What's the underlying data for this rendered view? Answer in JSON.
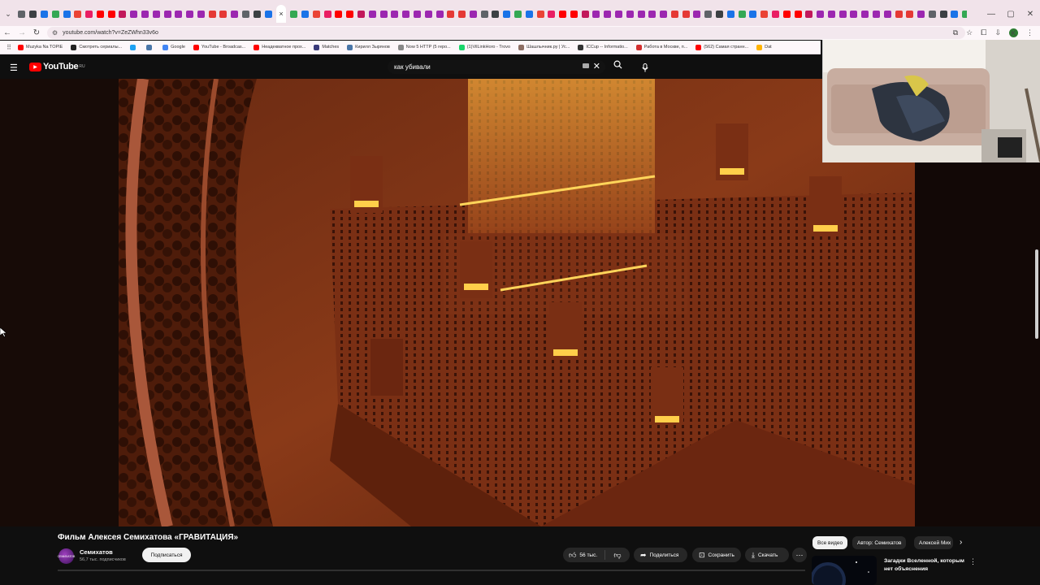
{
  "browser": {
    "url": "youtube.com/watch?v=ZeZWhn33v6o",
    "tab_colors": [
      "#5f6368",
      "#3c4043",
      "#1a73e8",
      "#34a853",
      "#1a73e8",
      "#ea4335",
      "#e91e63",
      "#ff0000",
      "#ff0000",
      "#c2185b",
      "#9c27b0",
      "#9c27b0",
      "#9c27b0",
      "#9c27b0",
      "#9c27b0",
      "#9c27b0",
      "#9c27b0",
      "#e53935",
      "#e53935",
      "#9c27b0"
    ],
    "bookmarks": [
      {
        "label": "Muzyka Na TOPIE",
        "color": "#ff0000"
      },
      {
        "label": "Смотреть сериалы...",
        "color": "#222222"
      },
      {
        "label": "",
        "color": "#1da1f2"
      },
      {
        "label": "",
        "color": "#4a76a8"
      },
      {
        "label": "Google",
        "color": "#4285f4"
      },
      {
        "label": "YouTube - Broadcas...",
        "color": "#ff0000"
      },
      {
        "label": "Неадекватное прох...",
        "color": "#ff0000"
      },
      {
        "label": "Matches",
        "color": "#3a3a7a"
      },
      {
        "label": "Кирилл Зырянов",
        "color": "#4a76a8"
      },
      {
        "label": "Now 5 HTTP (5 repo...",
        "color": "#888888"
      },
      {
        "label": "(1)VilLinkHoro - Trovo",
        "color": "#19d66b"
      },
      {
        "label": "Шашлычник.ру | Ус...",
        "color": "#8d6e63"
      },
      {
        "label": "ICCup -- Informatio...",
        "color": "#333333"
      },
      {
        "label": "Работа в Москве, п...",
        "color": "#d32f2f"
      },
      {
        "label": "(562) Самая странн...",
        "color": "#ff0000"
      },
      {
        "label": "Dat",
        "color": "#ffb300"
      }
    ]
  },
  "youtube": {
    "logo_text": "YouTube",
    "logo_region": "RU",
    "search_query": "как убивали"
  },
  "video": {
    "title": "Фильм Алексея Семихатова «ГРАВИТАЦИЯ»",
    "channel_avatar_text": "СЕМИХАТОВ",
    "channel_name": "Семихатов",
    "subscribers": "56,7 тыс. подписчиков",
    "subscribe_label": "Подписаться",
    "likes": "56 тыс.",
    "share_label": "Поделиться",
    "save_label": "Сохранить",
    "download_label": "Скачать"
  },
  "recommendations": {
    "chips": [
      "Все видео",
      "Автор: Семихатов",
      "Алексей Мих"
    ],
    "first_title": "Загадки Вселенной, которым нет объяснения"
  },
  "colors": {
    "yt_red": "#ff0000",
    "background": "#0f0f0f",
    "video_tint": "#8a3a18"
  }
}
